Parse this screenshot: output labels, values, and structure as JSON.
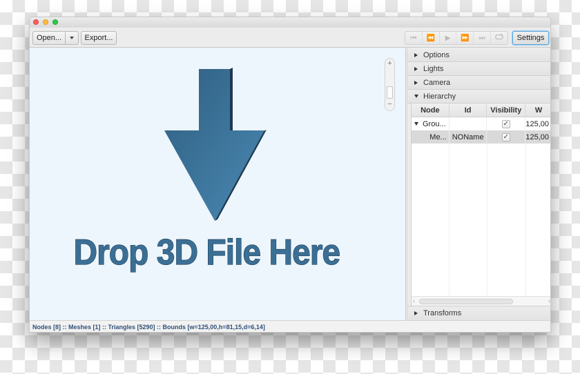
{
  "window": {
    "controls": [
      "close",
      "minimize",
      "maximize"
    ]
  },
  "toolbar": {
    "open_label": "Open...",
    "export_label": "Export...",
    "media_controls": [
      {
        "name": "skip-to-start-icon",
        "glyph": "⏮"
      },
      {
        "name": "rewind-icon",
        "glyph": "⏪"
      },
      {
        "name": "play-icon",
        "glyph": "▶"
      },
      {
        "name": "fast-forward-icon",
        "glyph": "⏩"
      },
      {
        "name": "skip-to-end-icon",
        "glyph": "⏭"
      },
      {
        "name": "loop-icon",
        "glyph": "🔁"
      }
    ],
    "settings_label": "Settings"
  },
  "viewport": {
    "drop_text": "Drop 3D File Here",
    "zoom_plus": "+",
    "zoom_minus": "−",
    "art_color": "#3a6e93"
  },
  "sidepanel": {
    "sections": {
      "options": "Options",
      "lights": "Lights",
      "camera": "Camera",
      "hierarchy": "Hierarchy",
      "transforms": "Transforms"
    },
    "hierarchy_table": {
      "columns": [
        "Node",
        "Id",
        "Visibility",
        "W"
      ],
      "rows": [
        {
          "node": "Grou...",
          "id": "",
          "visible": true,
          "w": "125,00",
          "expanded": true,
          "selected": false
        },
        {
          "node": "Me...",
          "id": "NOName",
          "visible": true,
          "w": "125,00",
          "selected": true
        }
      ],
      "scroll_left": "‹",
      "scroll_right": "›"
    }
  },
  "statusbar": {
    "text": "Nodes [8] :: Meshes [1] :: Triangles [5290] :: Bounds [w=125,00,h=81,15,d=6,14]"
  }
}
